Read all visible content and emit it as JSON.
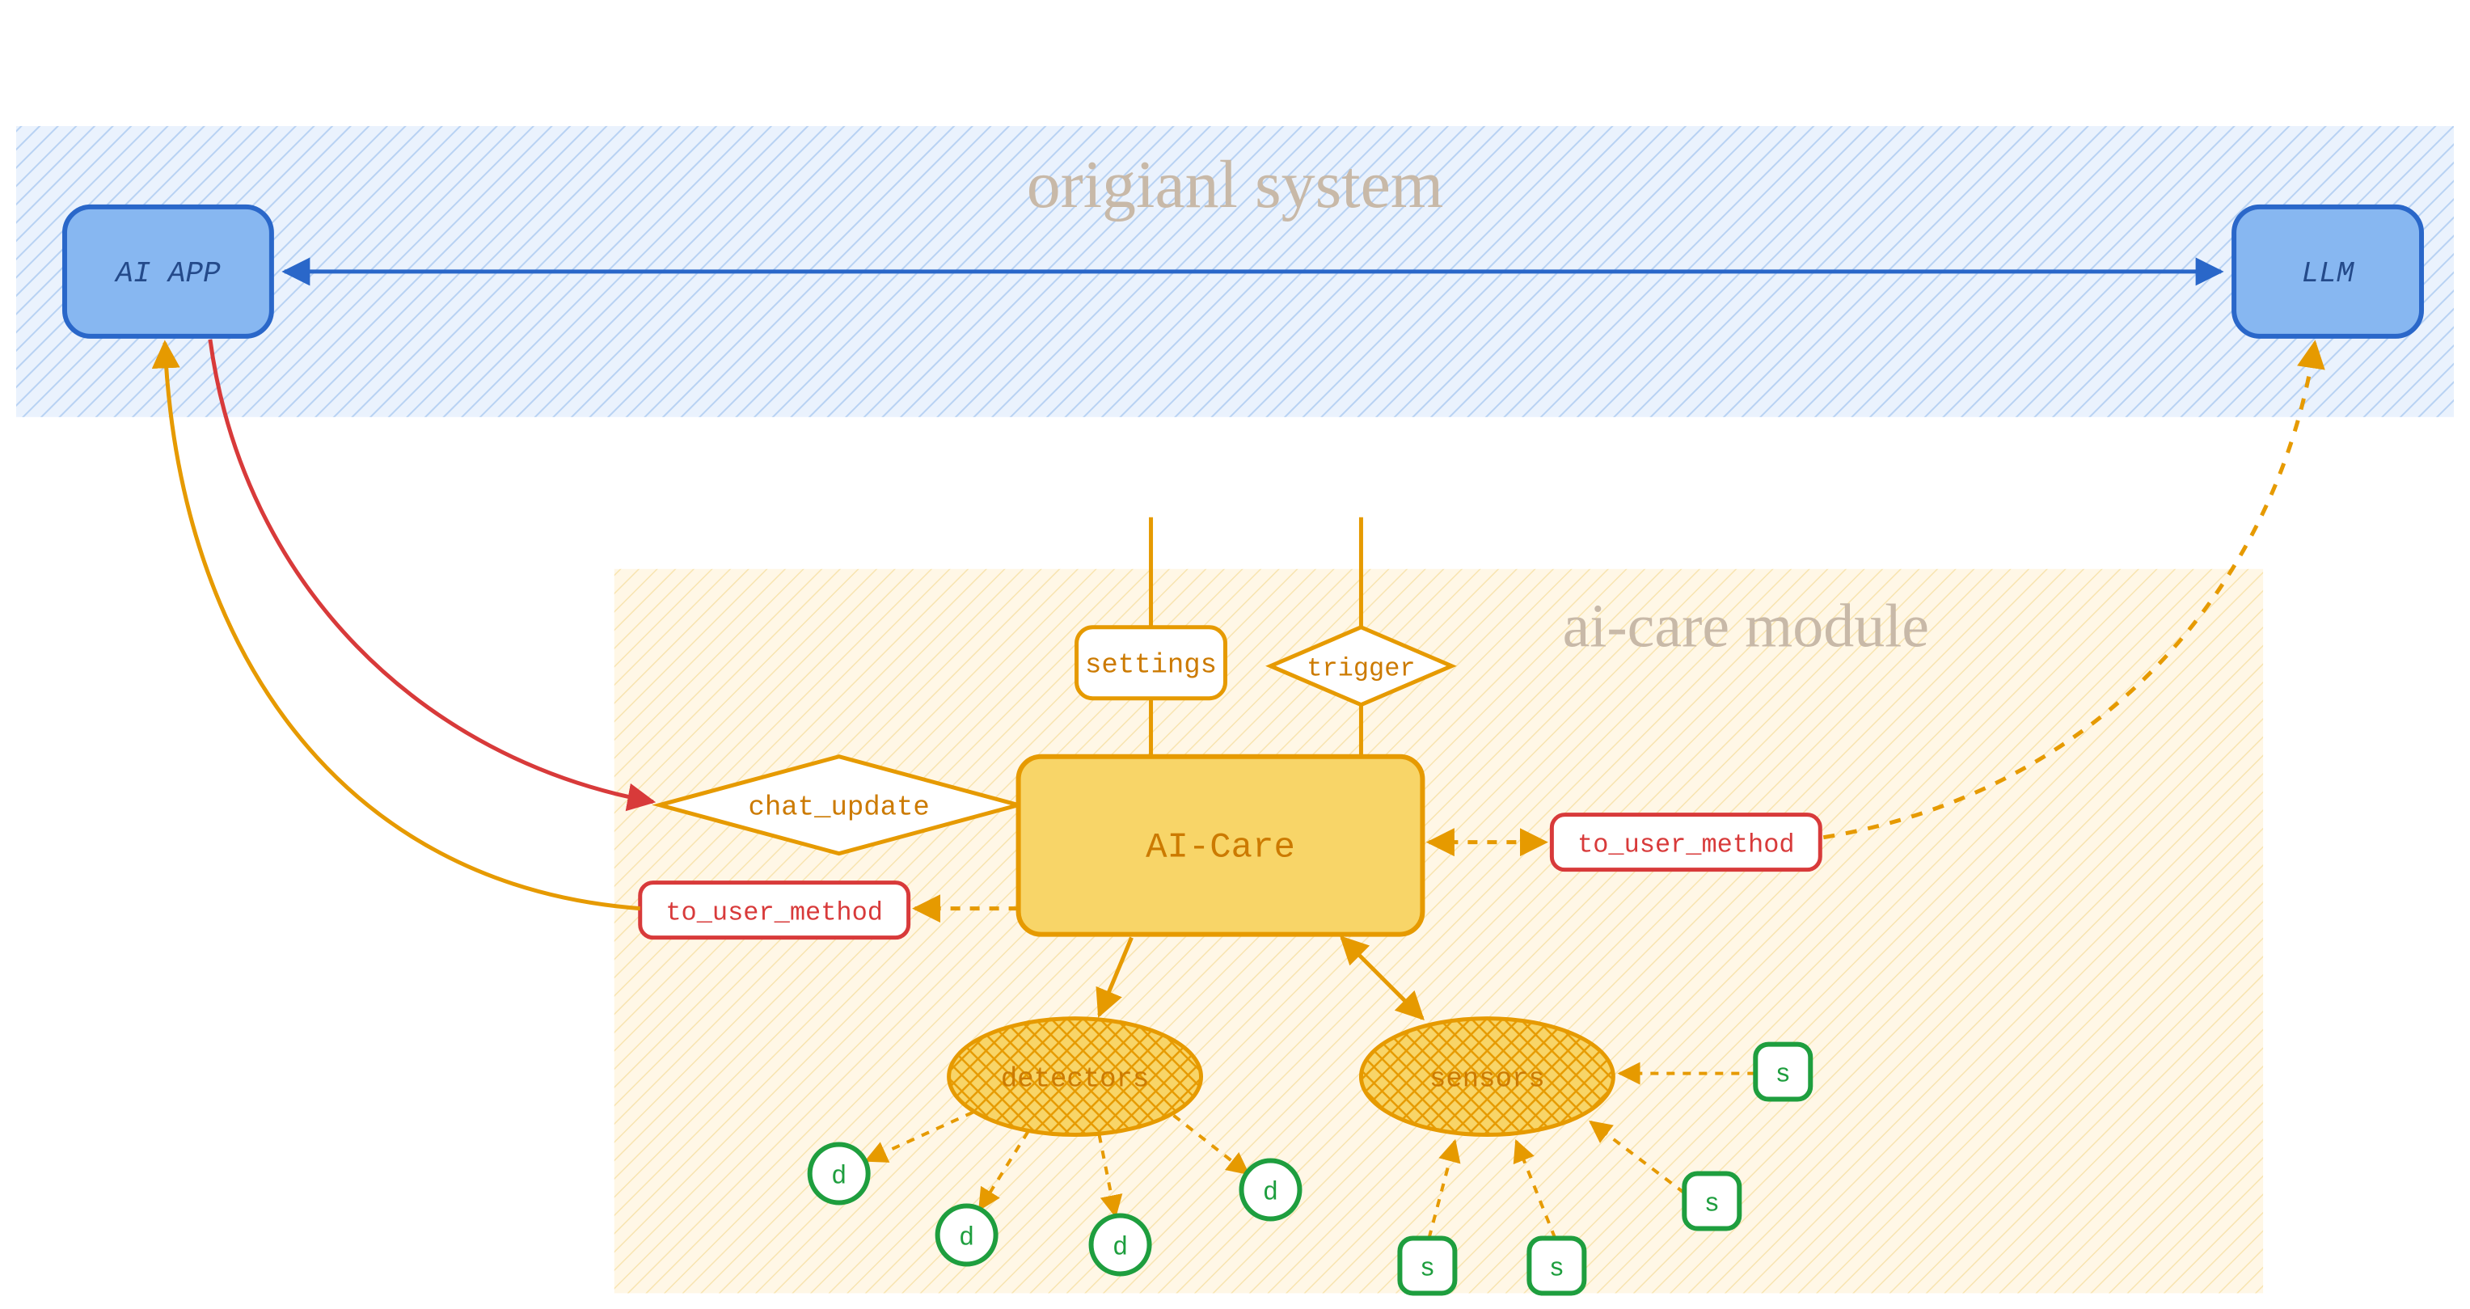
{
  "chart_data": {
    "type": "diagram",
    "title": "",
    "regions": [
      {
        "id": "original_system",
        "label": "origianl system",
        "fill": "#d7e7fb",
        "hatch": true,
        "border": "#2a67c9"
      },
      {
        "id": "ai_care_module",
        "label": "ai-care module",
        "fill": "#fdecc8",
        "hatch": true,
        "border": "#e69a00"
      }
    ],
    "nodes": [
      {
        "id": "ai_app",
        "label": "AI APP",
        "shape": "rounded-rect",
        "fill": "#87b7f1",
        "border": "#2a67c9",
        "text": "#244a8a",
        "region": "original_system"
      },
      {
        "id": "llm",
        "label": "LLM",
        "shape": "rounded-rect",
        "fill": "#87b7f1",
        "border": "#2a67c9",
        "text": "#244a8a",
        "region": "original_system"
      },
      {
        "id": "settings",
        "label": "settings",
        "shape": "rounded-rect",
        "fill": "#ffffff",
        "border": "#e69a00",
        "text": "#cc7a00",
        "region": "ai_care_module"
      },
      {
        "id": "trigger",
        "label": "trigger",
        "shape": "diamond",
        "fill": "#ffffff",
        "border": "#e69a00",
        "text": "#cc7a00",
        "region": "ai_care_module"
      },
      {
        "id": "chat_update",
        "label": "chat_update",
        "shape": "diamond",
        "fill": "#ffffff",
        "border": "#e69a00",
        "text": "#cc7a00",
        "region": "ai_care_module"
      },
      {
        "id": "ai_care",
        "label": "AI-Care",
        "shape": "rounded-rect",
        "fill": "#f8d568",
        "border": "#e69a00",
        "text": "#cc7a00",
        "region": "ai_care_module"
      },
      {
        "id": "to_user_left",
        "label": "to_user_method",
        "shape": "rounded-rect",
        "fill": "#ffffff",
        "border": "#d83a3a",
        "text": "#d83a3a",
        "region": "ai_care_module"
      },
      {
        "id": "to_user_right",
        "label": "to_user_method",
        "shape": "rounded-rect",
        "fill": "#ffffff",
        "border": "#d83a3a",
        "text": "#d83a3a",
        "region": "ai_care_module"
      },
      {
        "id": "detectors",
        "label": "detectors",
        "shape": "ellipse",
        "fill": "#f8d568",
        "border": "#e69a00",
        "text": "#cc7a00",
        "crosshatch": true,
        "region": "ai_care_module"
      },
      {
        "id": "sensors",
        "label": "sensors",
        "shape": "ellipse",
        "fill": "#f8d568",
        "border": "#e69a00",
        "text": "#cc7a00",
        "crosshatch": true,
        "region": "ai_care_module"
      },
      {
        "id": "d1",
        "label": "d",
        "shape": "circle",
        "fill": "#ffffff",
        "border": "#1e9e3e",
        "text": "#1e9e3e",
        "region": "ai_care_module"
      },
      {
        "id": "d2",
        "label": "d",
        "shape": "circle",
        "fill": "#ffffff",
        "border": "#1e9e3e",
        "text": "#1e9e3e",
        "region": "ai_care_module"
      },
      {
        "id": "d3",
        "label": "d",
        "shape": "circle",
        "fill": "#ffffff",
        "border": "#1e9e3e",
        "text": "#1e9e3e",
        "region": "ai_care_module"
      },
      {
        "id": "d4",
        "label": "d",
        "shape": "circle",
        "fill": "#ffffff",
        "border": "#1e9e3e",
        "text": "#1e9e3e",
        "region": "ai_care_module"
      },
      {
        "id": "s1",
        "label": "s",
        "shape": "rounded-square",
        "fill": "#ffffff",
        "border": "#1e9e3e",
        "text": "#1e9e3e",
        "region": "ai_care_module"
      },
      {
        "id": "s2",
        "label": "s",
        "shape": "rounded-square",
        "fill": "#ffffff",
        "border": "#1e9e3e",
        "text": "#1e9e3e",
        "region": "ai_care_module"
      },
      {
        "id": "s3",
        "label": "s",
        "shape": "rounded-square",
        "fill": "#ffffff",
        "border": "#1e9e3e",
        "text": "#1e9e3e",
        "region": "ai_care_module"
      },
      {
        "id": "s4",
        "label": "s",
        "shape": "rounded-square",
        "fill": "#ffffff",
        "border": "#1e9e3e",
        "text": "#1e9e3e",
        "region": "ai_care_module"
      }
    ],
    "edges": [
      {
        "from": "ai_app",
        "to": "llm",
        "style": "solid",
        "color": "#2a67c9",
        "arrow": "both"
      },
      {
        "from": "ai_app",
        "to": "chat_update",
        "style": "solid",
        "color": "#d83a3a",
        "arrow": "to"
      },
      {
        "from": "to_user_left",
        "to": "ai_app",
        "style": "solid",
        "color": "#e69a00",
        "arrow": "to"
      },
      {
        "from": "ai_care",
        "to": "to_user_left",
        "style": "dashed",
        "color": "#e69a00",
        "arrow": "to"
      },
      {
        "from": "ai_care",
        "to": "to_user_right",
        "style": "dashed",
        "color": "#e69a00",
        "arrow": "both"
      },
      {
        "from": "to_user_right",
        "to": "llm",
        "style": "dashed",
        "color": "#e69a00",
        "arrow": "to"
      },
      {
        "from": "settings",
        "to": "ai_care",
        "style": "solid",
        "color": "#e69a00",
        "arrow": "none"
      },
      {
        "from": "trigger",
        "to": "ai_care",
        "style": "solid",
        "color": "#e69a00",
        "arrow": "none"
      },
      {
        "from": "chat_update",
        "to": "ai_care",
        "style": "solid",
        "color": "#e69a00",
        "arrow": "none"
      },
      {
        "from": "ai_care",
        "to": "detectors",
        "style": "solid",
        "color": "#e69a00",
        "arrow": "to"
      },
      {
        "from": "ai_care",
        "to": "sensors",
        "style": "solid",
        "color": "#e69a00",
        "arrow": "both"
      },
      {
        "from": "detectors",
        "to": "d1",
        "style": "dashed",
        "color": "#e69a00",
        "arrow": "to"
      },
      {
        "from": "detectors",
        "to": "d2",
        "style": "dashed",
        "color": "#e69a00",
        "arrow": "to"
      },
      {
        "from": "detectors",
        "to": "d3",
        "style": "dashed",
        "color": "#e69a00",
        "arrow": "to"
      },
      {
        "from": "detectors",
        "to": "d4",
        "style": "dashed",
        "color": "#e69a00",
        "arrow": "to"
      },
      {
        "from": "s1",
        "to": "sensors",
        "style": "dashed",
        "color": "#e69a00",
        "arrow": "to"
      },
      {
        "from": "s2",
        "to": "sensors",
        "style": "dashed",
        "color": "#e69a00",
        "arrow": "to"
      },
      {
        "from": "s3",
        "to": "sensors",
        "style": "dashed",
        "color": "#e69a00",
        "arrow": "to"
      },
      {
        "from": "s4",
        "to": "sensors",
        "style": "dashed",
        "color": "#e69a00",
        "arrow": "to"
      }
    ]
  },
  "labels": {
    "original_system": "origianl system",
    "ai_care_module": "ai-care module",
    "ai_app": "AI APP",
    "llm": "LLM",
    "settings": "settings",
    "trigger": "trigger",
    "chat_update": "chat_update",
    "ai_care": "AI-Care",
    "to_user_method": "to_user_method",
    "detectors": "detectors",
    "sensors": "sensors",
    "d": "d",
    "s": "s"
  }
}
